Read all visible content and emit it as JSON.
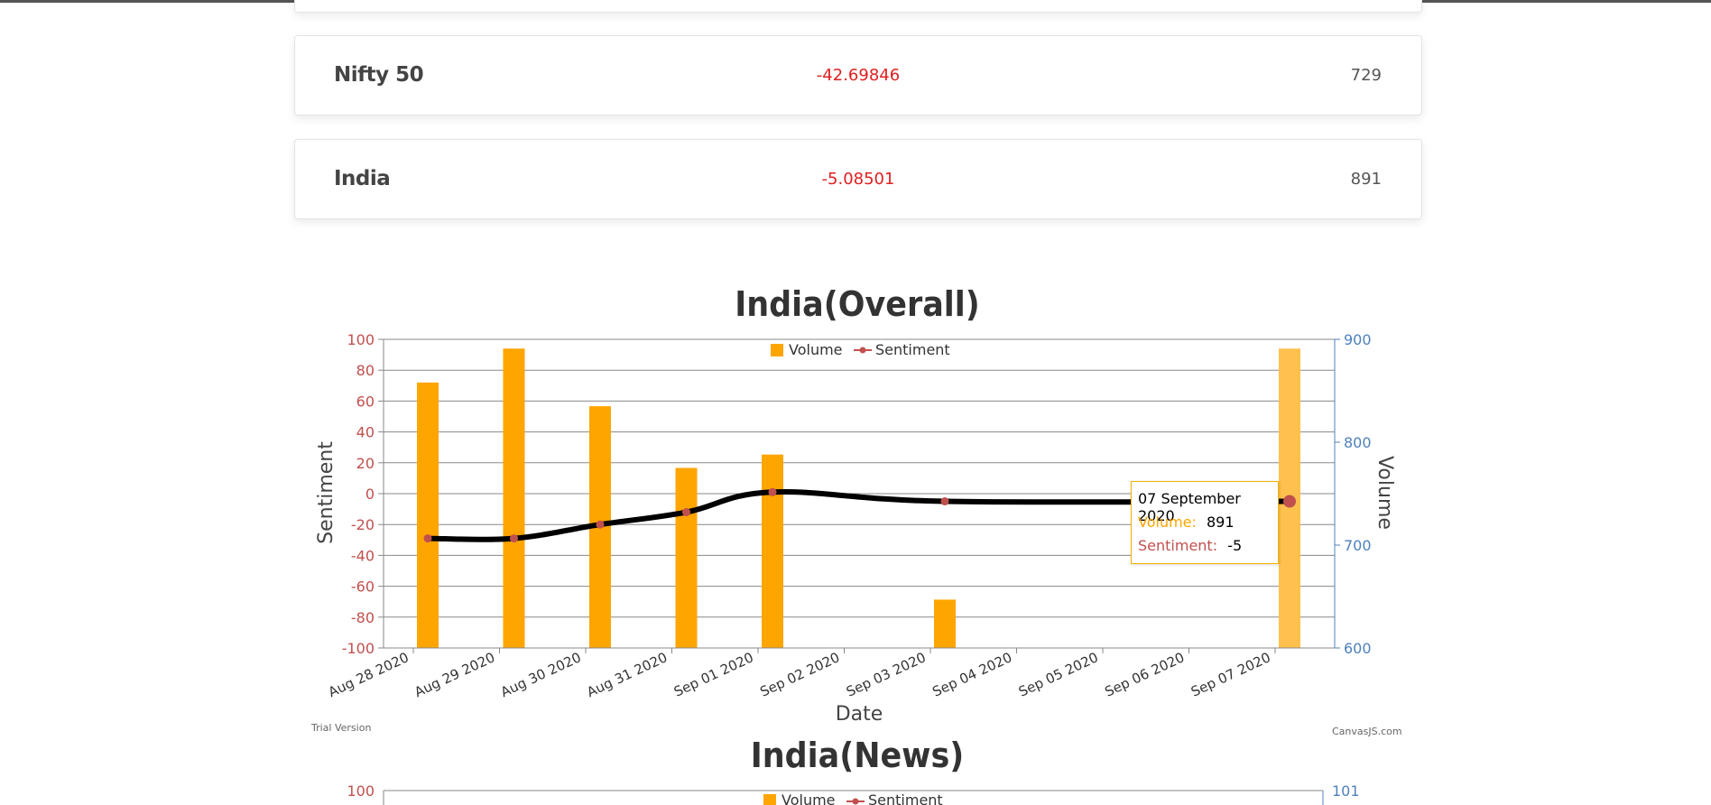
{
  "rows": [
    {
      "name": "Nifty 50",
      "sentiment": "-42.69846",
      "volume": "729"
    },
    {
      "name": "India",
      "sentiment": "-5.08501",
      "volume": "891"
    }
  ],
  "colors": {
    "bar": "#FFA500",
    "line": "#000000",
    "marker": "#C0504E",
    "left_axis": "#C0504E",
    "right_axis": "#4F81BC",
    "negative": "#e02020"
  },
  "chart_data": [
    {
      "type": "bar",
      "title": "India(Overall)",
      "xlabel": "Date",
      "ylabel": "Sentiment",
      "y2label": "Volume",
      "categories": [
        "Aug 28 2020",
        "Aug 29 2020",
        "Aug 30 2020",
        "Aug 31 2020",
        "Sep 01 2020",
        "Sep 02 2020",
        "Sep 03 2020",
        "Sep 04 2020",
        "Sep 05 2020",
        "Sep 06 2020",
        "Sep 07 2020"
      ],
      "ylim": [
        -100,
        100
      ],
      "y2lim": [
        600,
        900
      ],
      "yticks": [
        "100",
        "80",
        "60",
        "40",
        "20",
        "0",
        "-20",
        "-40",
        "-60",
        "-80",
        "-100"
      ],
      "y2ticks": [
        "900",
        "800",
        "700",
        "600"
      ],
      "grid": true,
      "legend": "top-center",
      "legend_labels": [
        "Volume",
        "Sentiment"
      ],
      "series": [
        {
          "name": "Volume",
          "type": "bar",
          "axis": "right",
          "points": [
            {
              "x": "Aug 28 2020",
              "y": 858
            },
            {
              "x": "Aug 29 2020",
              "y": 891
            },
            {
              "x": "Aug 30 2020",
              "y": 835
            },
            {
              "x": "Aug 31 2020",
              "y": 775
            },
            {
              "x": "Sep 01 2020",
              "y": 788
            },
            {
              "x": "Sep 03 2020",
              "y": 647
            },
            {
              "x": "Sep 07 2020",
              "y": 891
            }
          ]
        },
        {
          "name": "Sentiment",
          "type": "spline",
          "axis": "left",
          "points": [
            {
              "x": "Aug 28 2020",
              "y": -29
            },
            {
              "x": "Aug 29 2020",
              "y": -29
            },
            {
              "x": "Aug 30 2020",
              "y": -20
            },
            {
              "x": "Aug 31 2020",
              "y": -12
            },
            {
              "x": "Sep 01 2020",
              "y": 1
            },
            {
              "x": "Sep 03 2020",
              "y": -5
            },
            {
              "x": "Sep 07 2020",
              "y": -5
            }
          ]
        }
      ],
      "tooltip": {
        "date": "07 September 2020",
        "volume_label": "Volume:",
        "volume": "891",
        "sentiment_label": "Sentiment:",
        "sentiment": "-5"
      },
      "footer_left": "Trial Version",
      "footer_right": "CanvasJS.com"
    },
    {
      "type": "bar",
      "title": "India(News)",
      "ytick_top": "100",
      "y2tick_top": "101",
      "legend_labels": [
        "Volume",
        "Sentiment"
      ]
    }
  ]
}
